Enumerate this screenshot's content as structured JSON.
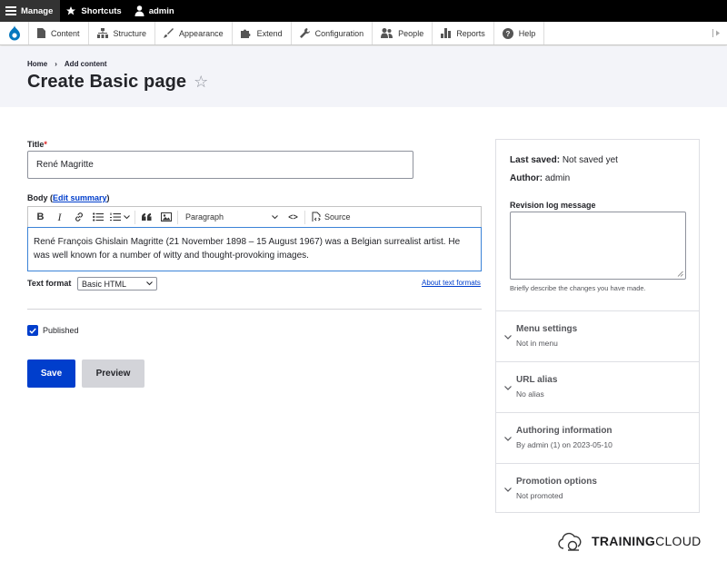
{
  "toolbar": {
    "manage_label": "Manage",
    "shortcuts_label": "Shortcuts",
    "user_label": "admin"
  },
  "tray": {
    "items": [
      {
        "label": "Content",
        "icon": "file-icon"
      },
      {
        "label": "Structure",
        "icon": "structure-icon"
      },
      {
        "label": "Appearance",
        "icon": "paintbrush-icon"
      },
      {
        "label": "Extend",
        "icon": "puzzle-icon"
      },
      {
        "label": "Configuration",
        "icon": "wrench-icon"
      },
      {
        "label": "People",
        "icon": "people-icon"
      },
      {
        "label": "Reports",
        "icon": "bar-chart-icon"
      },
      {
        "label": "Help",
        "icon": "help-icon"
      }
    ]
  },
  "header": {
    "breadcrumb_home": "Home",
    "breadcrumb_sep": "›",
    "breadcrumb_current": "Add content",
    "title": "Create Basic page",
    "star_glyph": "☆"
  },
  "form": {
    "title_label": "Title",
    "required_mark": "*",
    "title_value": "René Magritte",
    "body_label": "Body",
    "edit_summary_open": "(",
    "edit_summary_link": "Edit summary",
    "edit_summary_close": ")",
    "editor": {
      "bold_glyph": "B",
      "italic_glyph": "I",
      "format_value": "Paragraph",
      "code_glyph": "<>",
      "source_label": "Source",
      "body_text": "René François Ghislain Magritte (21 November 1898 – 15 August 1967) was a Belgian surrealist artist. He was well known for a number of witty and thought-provoking images."
    },
    "text_format_label": "Text format",
    "text_format_value": "Basic HTML",
    "about_formats_link": "About text formats",
    "published_label": "Published",
    "published_checked": true,
    "save_label": "Save",
    "preview_label": "Preview"
  },
  "sidebar": {
    "last_saved_label": "Last saved:",
    "last_saved_value": "Not saved yet",
    "author_label": "Author:",
    "author_value": "admin",
    "revision_label": "Revision log message",
    "revision_help": "Briefly describe the changes you have made.",
    "sections": [
      {
        "title": "Menu settings",
        "summary": "Not in menu"
      },
      {
        "title": "URL alias",
        "summary": "No alias"
      },
      {
        "title": "Authoring information",
        "summary": "By admin (1) on 2023-05-10"
      },
      {
        "title": "Promotion options",
        "summary": "Not promoted"
      }
    ]
  },
  "brand": {
    "text_bold": "TRAINING",
    "text_regular": "CLOUD"
  },
  "colors": {
    "primary": "#003ecc",
    "header_bg": "#f3f4f9",
    "toolbar_bg": "#000000",
    "drupal_blue": "#0678be"
  }
}
